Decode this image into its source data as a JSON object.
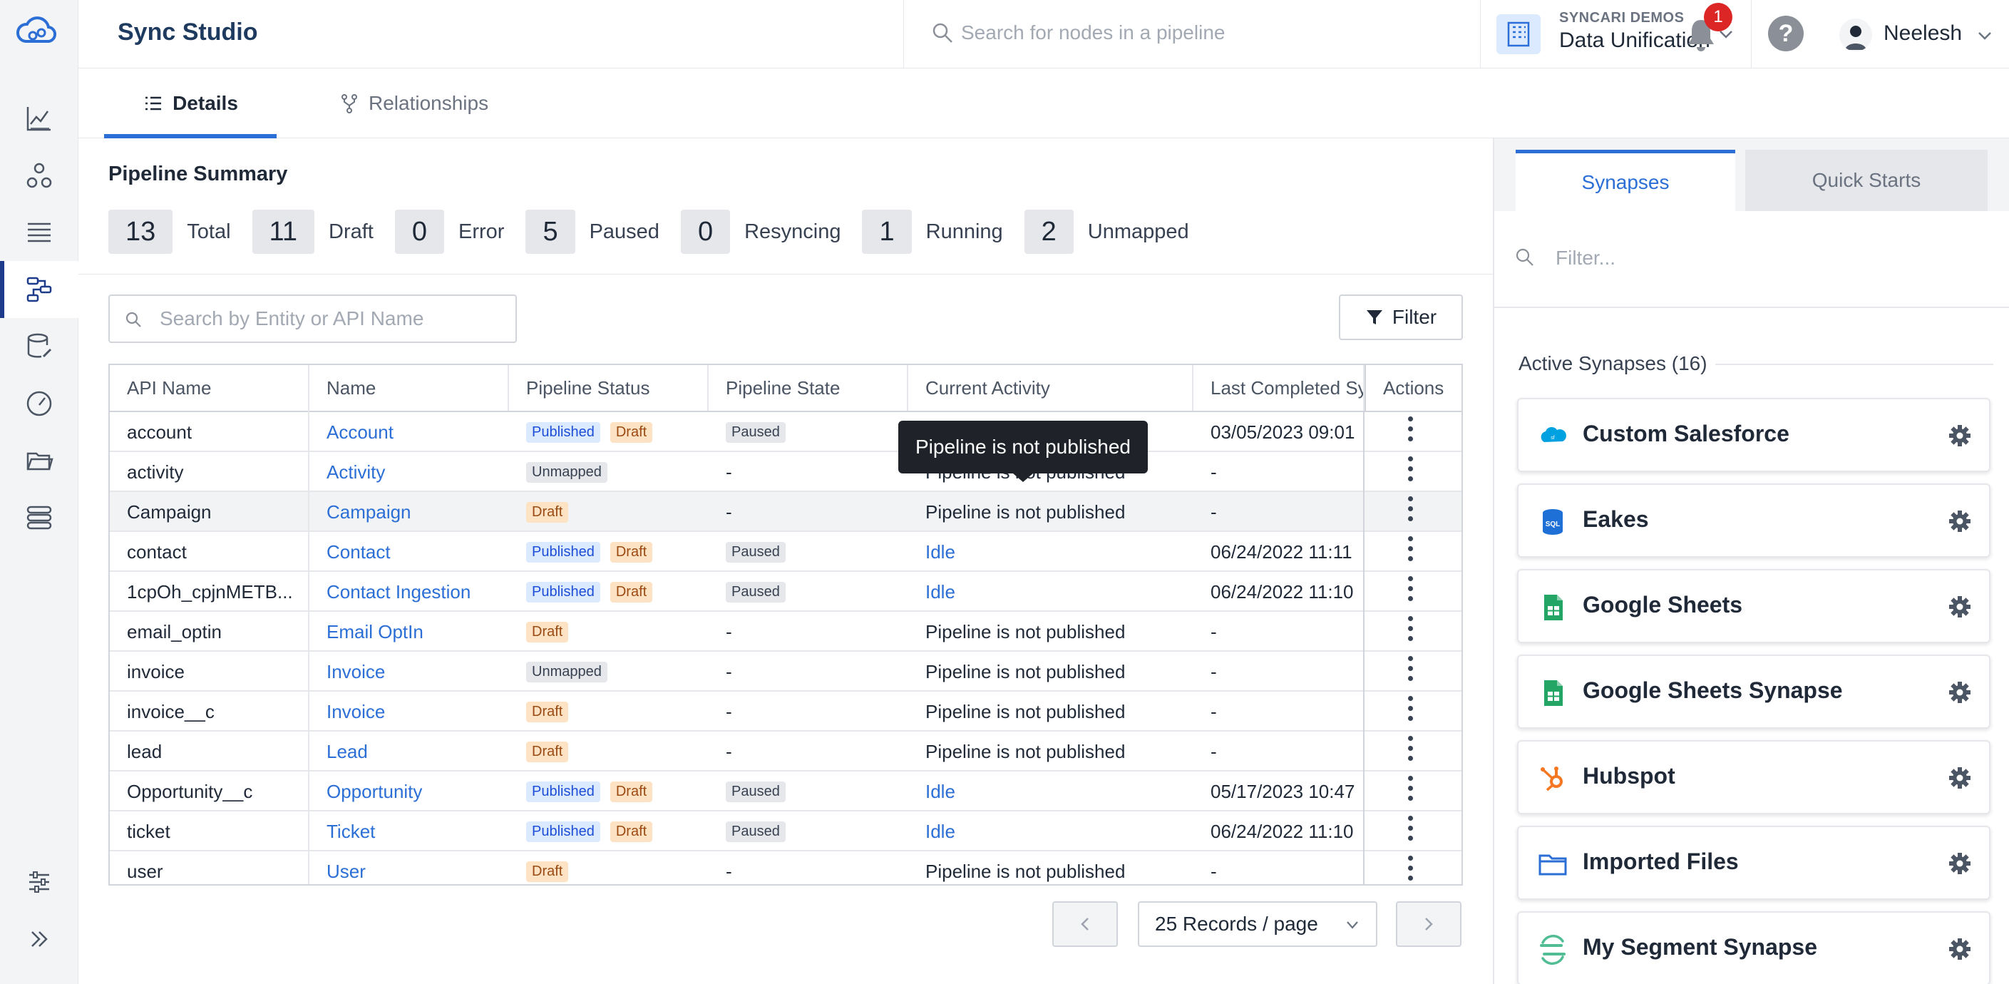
{
  "app": {
    "title": "Sync Studio"
  },
  "header": {
    "node_search_placeholder": "Search for nodes in a pipeline",
    "org_label": "SYNCARI DEMOS",
    "org_name": "Data Unification",
    "notification_count": "1",
    "help_label": "?",
    "user_name": "Neelesh"
  },
  "tabs": {
    "details": "Details",
    "relationships": "Relationships"
  },
  "summary": {
    "title": "Pipeline Summary",
    "stats": [
      {
        "value": "13",
        "label": "Total"
      },
      {
        "value": "11",
        "label": "Draft"
      },
      {
        "value": "0",
        "label": "Error"
      },
      {
        "value": "5",
        "label": "Paused"
      },
      {
        "value": "0",
        "label": "Resyncing"
      },
      {
        "value": "1",
        "label": "Running"
      },
      {
        "value": "2",
        "label": "Unmapped"
      }
    ]
  },
  "entity_search_placeholder": "Search by Entity or API Name",
  "filter_label": "Filter",
  "table": {
    "headers": [
      "API Name",
      "Name",
      "Pipeline Status",
      "Pipeline State",
      "Current Activity",
      "Last Completed Sy",
      "Actions"
    ],
    "rows": [
      {
        "api": "account",
        "name": "Account",
        "status": [
          "Published",
          "Draft"
        ],
        "state": "Paused",
        "activity": "",
        "activity_link": false,
        "last": "03/05/2023 09:01"
      },
      {
        "api": "activity",
        "name": "Activity",
        "status": [
          "Unmapped"
        ],
        "state": "-",
        "activity": "Pipeline is not published",
        "activity_link": false,
        "last": "-"
      },
      {
        "api": "Campaign",
        "name": "Campaign",
        "status": [
          "Draft"
        ],
        "state": "-",
        "activity": "Pipeline is not published",
        "activity_link": false,
        "last": "-"
      },
      {
        "api": "contact",
        "name": "Contact",
        "status": [
          "Published",
          "Draft"
        ],
        "state": "Paused",
        "activity": "Idle",
        "activity_link": true,
        "last": "06/24/2022 11:11"
      },
      {
        "api": "1cpOh_cpjnMETB...",
        "name": "Contact Ingestion",
        "status": [
          "Published",
          "Draft"
        ],
        "state": "Paused",
        "activity": "Idle",
        "activity_link": true,
        "last": "06/24/2022 11:10"
      },
      {
        "api": "email_optin",
        "name": "Email OptIn",
        "status": [
          "Draft"
        ],
        "state": "-",
        "activity": "Pipeline is not published",
        "activity_link": false,
        "last": "-"
      },
      {
        "api": "invoice",
        "name": "Invoice",
        "status": [
          "Unmapped"
        ],
        "state": "-",
        "activity": "Pipeline is not published",
        "activity_link": false,
        "last": "-"
      },
      {
        "api": "invoice__c",
        "name": "Invoice",
        "status": [
          "Draft"
        ],
        "state": "-",
        "activity": "Pipeline is not published",
        "activity_link": false,
        "last": "-"
      },
      {
        "api": "lead",
        "name": "Lead",
        "status": [
          "Draft"
        ],
        "state": "-",
        "activity": "Pipeline is not published",
        "activity_link": false,
        "last": "-"
      },
      {
        "api": "Opportunity__c",
        "name": "Opportunity",
        "status": [
          "Published",
          "Draft"
        ],
        "state": "Paused",
        "activity": "Idle",
        "activity_link": true,
        "last": "05/17/2023 10:47"
      },
      {
        "api": "ticket",
        "name": "Ticket",
        "status": [
          "Published",
          "Draft"
        ],
        "state": "Paused",
        "activity": "Idle",
        "activity_link": true,
        "last": "06/24/2022 11:10"
      },
      {
        "api": "user",
        "name": "User",
        "status": [
          "Draft"
        ],
        "state": "-",
        "activity": "Pipeline is not published",
        "activity_link": false,
        "last": "-"
      }
    ]
  },
  "tooltip": "Pipeline is not published",
  "pagination": {
    "page_size": "25 Records / page"
  },
  "right_panel": {
    "tabs": {
      "synapses": "Synapses",
      "quick_starts": "Quick Starts"
    },
    "filter_placeholder": "Filter...",
    "active_heading": "Active Synapses (16)",
    "synapses": [
      {
        "name": "Custom Salesforce",
        "icon": "salesforce-icon"
      },
      {
        "name": "Eakes",
        "icon": "sql-icon"
      },
      {
        "name": "Google Sheets",
        "icon": "google-sheets-icon"
      },
      {
        "name": "Google Sheets Synapse",
        "icon": "google-sheets-icon"
      },
      {
        "name": "Hubspot",
        "icon": "hubspot-icon"
      },
      {
        "name": "Imported Files",
        "icon": "folder-icon"
      },
      {
        "name": "My Segment Synapse",
        "icon": "segment-icon"
      }
    ]
  },
  "colors": {
    "accent": "#2b6fd6",
    "draft": "#fde2c4",
    "published": "#dbeafe",
    "brand": "#1e3a5f"
  }
}
